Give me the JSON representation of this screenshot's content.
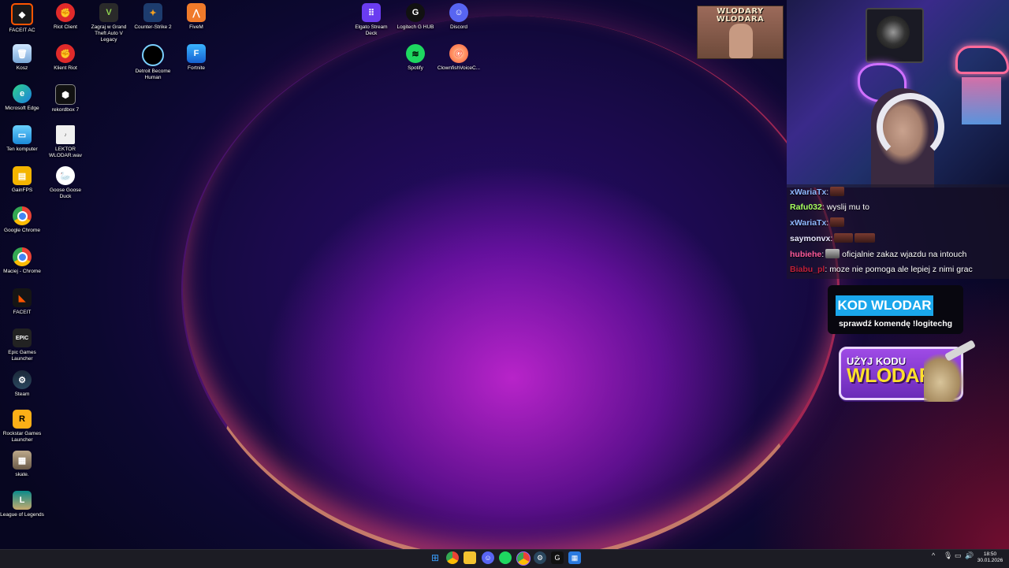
{
  "desktop_icons": {
    "faceit_ac": "FACEIT AC",
    "riot_client": "Riot Client",
    "gta": "Zagraj w Grand Theft Auto V Legacy",
    "cs2": "Counter-Strike 2",
    "fivem": "FiveM",
    "kosz": "Kosz",
    "klient_riot": "Klient Riot",
    "detroit": "Detroit Become Human",
    "fortnite": "Fortnite",
    "edge": "Microsoft Edge",
    "rekordbox": "rekordbox 7",
    "ten_komputer": "Ten komputer",
    "lektor": "LEKTOR WLODAR.wav",
    "gainfps": "GainFPS",
    "goose": "Goose Goose Duck",
    "chrome": "Google Chrome",
    "maciej_chrome": "Maciej - Chrome",
    "faceit": "FACEIT",
    "epic": "Epic Games Launcher",
    "steam": "Steam",
    "rockstar": "Rockstar Games Launcher",
    "skate": "skate.",
    "lol": "League of Legends",
    "elgato": "Elgato Stream Deck",
    "logitech": "Logitech G HUB",
    "discord": "Discord",
    "spotify": "Spotify",
    "clownfish": "ClownfishVoiceC..."
  },
  "overlay": {
    "banner_text": "WLODARY WLODARA",
    "chat": [
      {
        "user": "xWariaTx",
        "message": "",
        "user_color": "#8fb8ff",
        "emotes": 1
      },
      {
        "user": "Rafu032",
        "message": "wyslij mu to",
        "user_color": "#a8ff60",
        "emotes": 0
      },
      {
        "user": "xWariaTx",
        "message": "",
        "user_color": "#8fb8ff",
        "emotes": 1
      },
      {
        "user": "saymonvx",
        "message": "",
        "user_color": "#e8e8ff",
        "emotes": 2
      },
      {
        "user": "hubiehe",
        "message": "oficjalnie zakaz wjazdu na intouch",
        "user_color": "#ff5a9a",
        "emotes": 1
      },
      {
        "user": "Biabu_pl",
        "message": "moze nie pomoga ale lepiej z nimi grac",
        "user_color": "#c0203a",
        "emotes": 0
      }
    ],
    "kod_title": "KOD WLODAR",
    "kod_sub": "sprawdź komendę !logitechg",
    "uzyj_small": "UŻYJ KODU",
    "uzyj_big": "WLODAR"
  },
  "taskbar": {
    "time": "18:50",
    "date": "30.01.2026",
    "tray_chevron": "^",
    "apps": [
      "windows-start",
      "chrome",
      "file-explorer",
      "discord",
      "spotify",
      "chrome-profile",
      "steam",
      "logitech",
      "stream-deck"
    ]
  },
  "colors": {
    "chat_bg": "#1e1628",
    "kod_accent": "#1aa7ec",
    "uzyj_bg": "#8a3ee0",
    "uzyj_text": "#ffe12a"
  }
}
